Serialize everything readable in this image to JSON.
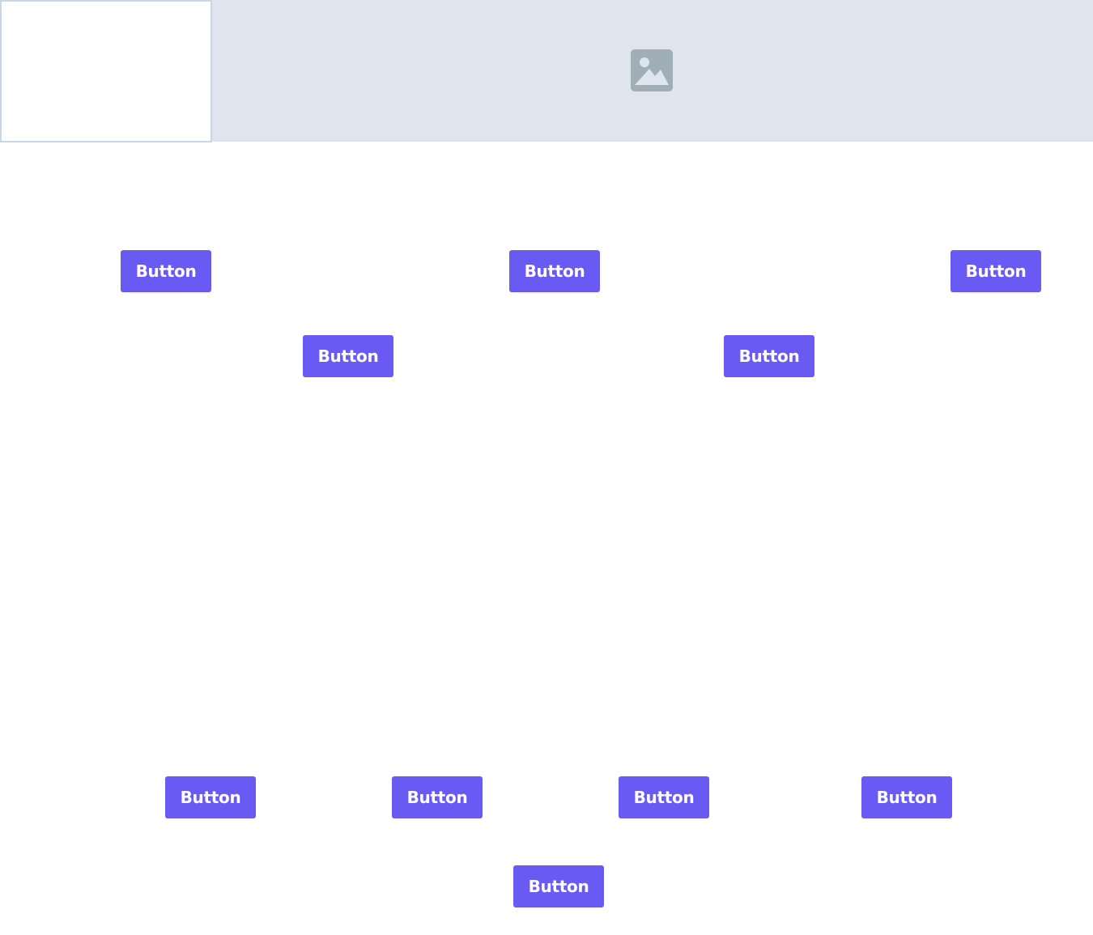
{
  "header": {
    "background_color": "#dfe5ee",
    "panel_border_color": "#c9d6e5",
    "image_icon": "image-icon",
    "image_icon_color": "#a0aeb8"
  },
  "accent_color": "#6a5af4",
  "buttons": [
    {
      "label": "Button"
    },
    {
      "label": "Button"
    },
    {
      "label": "Button"
    },
    {
      "label": "Button"
    },
    {
      "label": "Button"
    },
    {
      "label": "Button"
    },
    {
      "label": "Button"
    },
    {
      "label": "Button"
    },
    {
      "label": "Button"
    },
    {
      "label": "Button"
    }
  ]
}
